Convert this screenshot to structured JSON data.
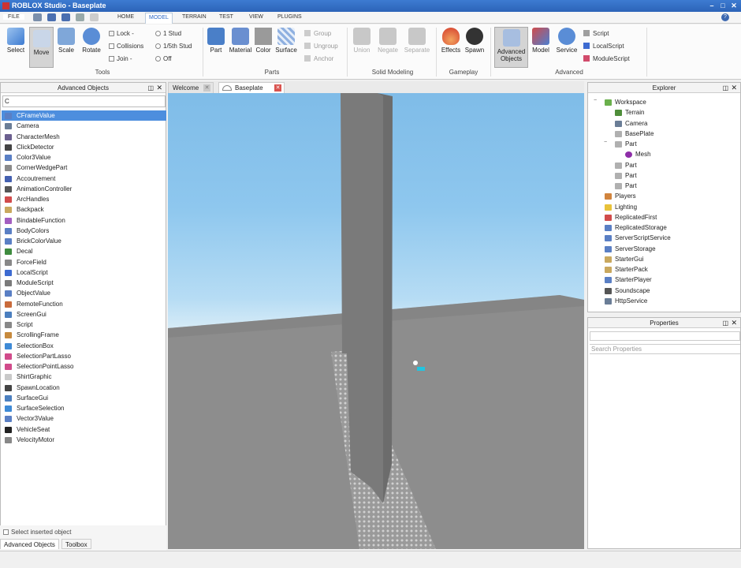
{
  "window": {
    "title": "ROBLOX Studio - Baseplate"
  },
  "menu": {
    "file": "FILE",
    "tabs": [
      "HOME",
      "MODEL",
      "TERRAIN",
      "TEST",
      "VIEW",
      "PLUGINS"
    ],
    "active_tab": "MODEL"
  },
  "ribbon": {
    "tools": {
      "select": "Select",
      "move": "Move",
      "scale": "Scale",
      "rotate": "Rotate",
      "group_label": "Tools"
    },
    "snap": {
      "lock": "Lock -",
      "collisions": "Collisions",
      "join": "Join -",
      "stud1": "1 Stud",
      "stud5": "1/5th Stud",
      "off": "Off"
    },
    "parts": {
      "part": "Part",
      "material": "Material",
      "color": "Color",
      "surface": "Surface",
      "group": "Group",
      "ungroup": "Ungroup",
      "anchor": "Anchor",
      "group_label": "Parts"
    },
    "solid": {
      "union": "Union",
      "negate": "Negate",
      "separate": "Separate",
      "group_label": "Solid Modeling"
    },
    "gameplay": {
      "effects": "Effects",
      "spawn": "Spawn",
      "group_label": "Gameplay"
    },
    "advanced": {
      "advanced_objects_1": "Advanced",
      "advanced_objects_2": "Objects",
      "model": "Model",
      "service": "Service",
      "script": "Script",
      "localscript": "LocalScript",
      "modulescript": "ModuleScript",
      "group_label": "Advanced"
    }
  },
  "advanced_objects": {
    "title": "Advanced Objects",
    "search_value": "C",
    "items": [
      {
        "label": "CFrameValue",
        "icon": "value-icon",
        "color": "#5a7fc4"
      },
      {
        "label": "Camera",
        "icon": "camera-icon",
        "color": "#6a7d96"
      },
      {
        "label": "CharacterMesh",
        "icon": "mesh-icon",
        "color": "#6b5f8f"
      },
      {
        "label": "ClickDetector",
        "icon": "click-icon",
        "color": "#444444"
      },
      {
        "label": "Color3Value",
        "icon": "value-icon",
        "color": "#5a7fc4"
      },
      {
        "label": "CornerWedgePart",
        "icon": "wedge-icon",
        "color": "#8a8a8a"
      },
      {
        "label": "Accoutrement",
        "icon": "hat-icon",
        "color": "#4460b0"
      },
      {
        "label": "AnimationController",
        "icon": "animation-icon",
        "color": "#555555"
      },
      {
        "label": "ArcHandles",
        "icon": "arc-icon",
        "color": "#d14b4b"
      },
      {
        "label": "Backpack",
        "icon": "backpack-icon",
        "color": "#c9a85e"
      },
      {
        "label": "BindableFunction",
        "icon": "function-icon",
        "color": "#a35ec0"
      },
      {
        "label": "BodyColors",
        "icon": "body-colors-icon",
        "color": "#5a7fc4"
      },
      {
        "label": "BrickColorValue",
        "icon": "value-icon",
        "color": "#5a7fc4"
      },
      {
        "label": "Decal",
        "icon": "decal-icon",
        "color": "#3f8c3f"
      },
      {
        "label": "ForceField",
        "icon": "forcefield-icon",
        "color": "#888888"
      },
      {
        "label": "LocalScript",
        "icon": "localscript-icon",
        "color": "#3d6bd1"
      },
      {
        "label": "ModuleScript",
        "icon": "modulescript-icon",
        "color": "#7a7a7a"
      },
      {
        "label": "ObjectValue",
        "icon": "value-icon",
        "color": "#5a7fc4"
      },
      {
        "label": "RemoteFunction",
        "icon": "remote-icon",
        "color": "#c96b3b"
      },
      {
        "label": "ScreenGui",
        "icon": "screengui-icon",
        "color": "#4b7fbf"
      },
      {
        "label": "Script",
        "icon": "script-icon",
        "color": "#888888"
      },
      {
        "label": "ScrollingFrame",
        "icon": "frame-icon",
        "color": "#c78a3d"
      },
      {
        "label": "SelectionBox",
        "icon": "selectionbox-icon",
        "color": "#3e8ad6"
      },
      {
        "label": "SelectionPartLasso",
        "icon": "lasso-icon",
        "color": "#d14b8b"
      },
      {
        "label": "SelectionPointLasso",
        "icon": "lasso-icon",
        "color": "#d14b8b"
      },
      {
        "label": "ShirtGraphic",
        "icon": "shirt-icon",
        "color": "#c9c9c9"
      },
      {
        "label": "SpawnLocation",
        "icon": "spawn-icon",
        "color": "#444444"
      },
      {
        "label": "SurfaceGui",
        "icon": "surfacegui-icon",
        "color": "#4b7fbf"
      },
      {
        "label": "SurfaceSelection",
        "icon": "surfaceselection-icon",
        "color": "#3e8ad6"
      },
      {
        "label": "Vector3Value",
        "icon": "value-icon",
        "color": "#5a7fc4"
      },
      {
        "label": "VehicleSeat",
        "icon": "seat-icon",
        "color": "#222222"
      },
      {
        "label": "VelocityMotor",
        "icon": "motor-icon",
        "color": "#888888"
      }
    ],
    "select_inserted_label": "Select inserted object",
    "bottom_tabs": [
      "Advanced Objects",
      "Toolbox"
    ]
  },
  "doc_tabs": {
    "welcome": "Welcome",
    "baseplate": "Baseplate"
  },
  "explorer": {
    "title": "Explorer",
    "items": [
      {
        "label": "Workspace",
        "icon": "workspace-icon",
        "color": "#6ab04c",
        "depth": 0,
        "expander": "minus"
      },
      {
        "label": "Terrain",
        "icon": "terrain-icon",
        "color": "#4f8e3a",
        "depth": 1,
        "expander": ""
      },
      {
        "label": "Camera",
        "icon": "camera-icon",
        "color": "#6a7d96",
        "depth": 1,
        "expander": ""
      },
      {
        "label": "BasePlate",
        "icon": "part-icon",
        "color": "#b0b0b0",
        "depth": 1,
        "expander": ""
      },
      {
        "label": "Part",
        "icon": "part-icon",
        "color": "#b0b0b0",
        "depth": 1,
        "expander": "minus"
      },
      {
        "label": "Mesh",
        "icon": "mesh-icon",
        "color": "#8e2ea8",
        "depth": 2,
        "expander": ""
      },
      {
        "label": "Part",
        "icon": "part-icon",
        "color": "#b0b0b0",
        "depth": 1,
        "expander": ""
      },
      {
        "label": "Part",
        "icon": "part-icon",
        "color": "#b0b0b0",
        "depth": 1,
        "expander": ""
      },
      {
        "label": "Part",
        "icon": "part-icon",
        "color": "#b0b0b0",
        "depth": 1,
        "expander": ""
      },
      {
        "label": "Players",
        "icon": "players-icon",
        "color": "#d1843d",
        "depth": 0,
        "expander": ""
      },
      {
        "label": "Lighting",
        "icon": "lighting-icon",
        "color": "#e8c23a",
        "depth": 0,
        "expander": ""
      },
      {
        "label": "ReplicatedFirst",
        "icon": "replicated-icon",
        "color": "#d14b4b",
        "depth": 0,
        "expander": ""
      },
      {
        "label": "ReplicatedStorage",
        "icon": "replicated-icon",
        "color": "#5a7fc4",
        "depth": 0,
        "expander": ""
      },
      {
        "label": "ServerScriptService",
        "icon": "server-icon",
        "color": "#5a7fc4",
        "depth": 0,
        "expander": ""
      },
      {
        "label": "ServerStorage",
        "icon": "server-icon",
        "color": "#5a7fc4",
        "depth": 0,
        "expander": ""
      },
      {
        "label": "StarterGui",
        "icon": "startergui-icon",
        "color": "#c9a85e",
        "depth": 0,
        "expander": ""
      },
      {
        "label": "StarterPack",
        "icon": "starterpack-icon",
        "color": "#c9a85e",
        "depth": 0,
        "expander": ""
      },
      {
        "label": "StarterPlayer",
        "icon": "starterplayer-icon",
        "color": "#5a7fc4",
        "depth": 0,
        "expander": ""
      },
      {
        "label": "Soundscape",
        "icon": "soundscape-icon",
        "color": "#555555",
        "depth": 0,
        "expander": ""
      },
      {
        "label": "HttpService",
        "icon": "http-icon",
        "color": "#6a7d96",
        "depth": 0,
        "expander": ""
      }
    ]
  },
  "properties": {
    "title": "Properties",
    "search_placeholder": "Search Properties"
  },
  "colors": {
    "accent": "#4d8ede",
    "sky_top": "#7fbce8",
    "ground": "#8a8a8a",
    "titlebar": "#2c64b8"
  }
}
